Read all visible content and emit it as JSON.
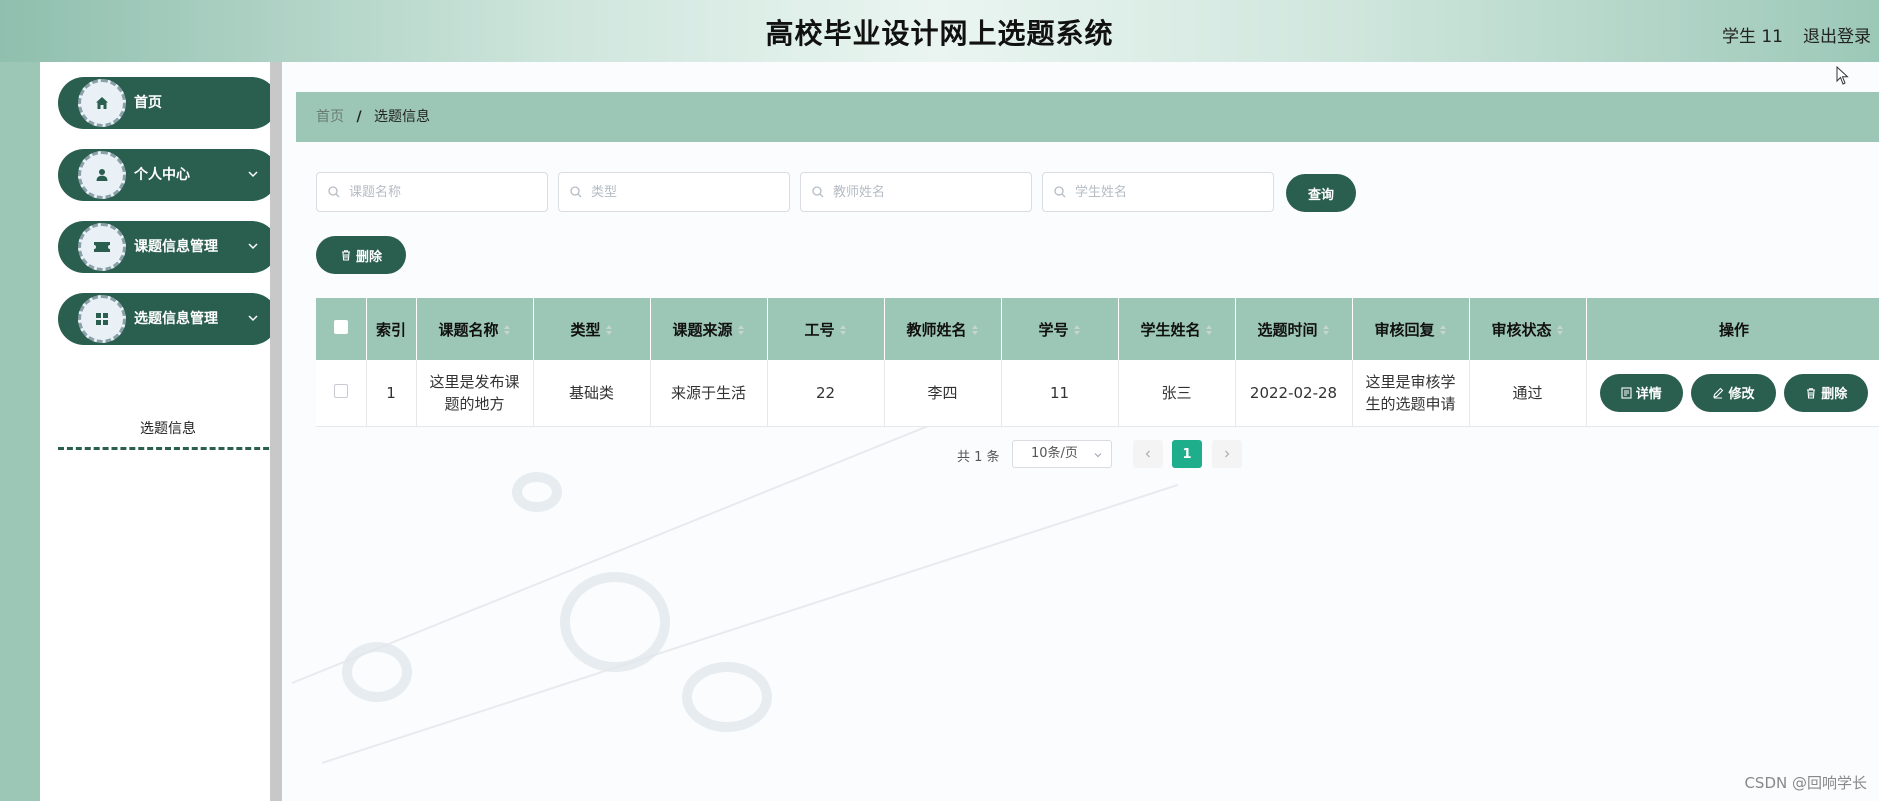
{
  "header": {
    "title": "高校毕业设计网上选题系统",
    "user": "学生 11",
    "logout": "退出登录"
  },
  "sidebar": {
    "items": [
      {
        "label": "首页",
        "icon": "home-icon"
      },
      {
        "label": "个人中心",
        "icon": "user-icon"
      },
      {
        "label": "课题信息管理",
        "icon": "ticket-icon"
      },
      {
        "label": "选题信息管理",
        "icon": "grid-icon"
      }
    ],
    "submenu": {
      "label": "选题信息"
    }
  },
  "breadcrumb": {
    "home": "首页",
    "separator": "/",
    "current": "选题信息"
  },
  "search": {
    "topic_placeholder": "课题名称",
    "type_placeholder": "类型",
    "teacher_placeholder": "教师姓名",
    "student_placeholder": "学生姓名",
    "query_label": "查询"
  },
  "toolbar": {
    "delete_label": "删除"
  },
  "table": {
    "headers": {
      "index": "索引",
      "topic": "课题名称",
      "type": "类型",
      "source": "课题来源",
      "staff_no": "工号",
      "teacher": "教师姓名",
      "student_no": "学号",
      "student": "学生姓名",
      "time": "选题时间",
      "reply": "审核回复",
      "status": "审核状态",
      "actions": "操作"
    },
    "rows": [
      {
        "index": "1",
        "topic": "这里是发布课题的地方",
        "type": "基础类",
        "source": "来源于生活",
        "staff_no": "22",
        "teacher": "李四",
        "student_no": "11",
        "student": "张三",
        "time": "2022-02-28",
        "reply": "这里是审核学生的选题申请",
        "status": "通过"
      }
    ],
    "actions": {
      "detail": "详情",
      "edit": "修改",
      "delete": "删除"
    }
  },
  "pagination": {
    "total": "共 1 条",
    "page_size": "10条/页",
    "current_page": "1"
  },
  "watermark": "CSDN @回响学长",
  "colors": {
    "primary": "#2a5e4e",
    "accent": "#9cc6b6",
    "page_active": "#1fae8c"
  }
}
